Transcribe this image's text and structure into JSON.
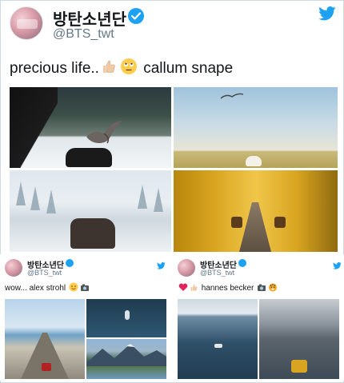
{
  "tweet": {
    "display_name": "방탄소년단",
    "handle": "@BTS_twt",
    "text_before": "precious life..",
    "text_after": "callum snape",
    "emojis": [
      "thumbs-up",
      "face-rolling-eyes"
    ]
  },
  "quoted_left": {
    "display_name": "방탄소년단",
    "handle": "@BTS_twt",
    "text": "wow... alex strohl",
    "emojis": [
      "smiling-face",
      "camera-with-flash"
    ]
  },
  "quoted_right": {
    "display_name": "방탄소년단",
    "handle": "@BTS_twt",
    "text": "hannes becker",
    "emojis": [
      "red-heart",
      "thumbs-up",
      "camera-with-flash",
      "tiger-face"
    ]
  },
  "colors": {
    "twitter_blue": "#1da1f2",
    "text_primary": "#14171a",
    "text_secondary": "#657786",
    "heart": "#e0245e"
  }
}
